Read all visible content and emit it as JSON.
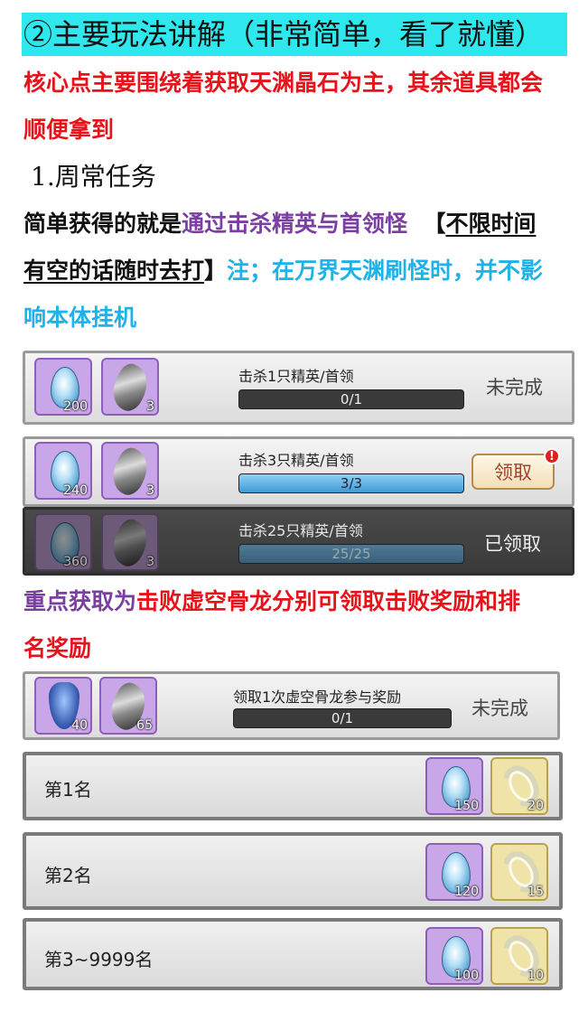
{
  "heading": "②主要玩法讲解（非常简单，看了就懂）",
  "intro_line1": "核心点主要围绕着获取天渊晶石为主，其余道具都会",
  "intro_line2": "顺便拿到",
  "section1_title": "1.周常任务",
  "desc_line1_a": "简单获得的就是",
  "desc_line1_b": "通过击杀精英与首领怪",
  "desc_line1_c": "【",
  "desc_line1_d": "不限时间",
  "desc_line2_a": "有空的话随时去打",
  "desc_line2_b": "】",
  "desc_line2_c": "注；在万界天渊刷怪时，并不影",
  "desc_line3": "响本体挂机",
  "weekly_tasks": [
    {
      "title": "击杀1只精英/首领",
      "progress": "0/1",
      "fraction": 0.0,
      "status": "未完成",
      "reward1_qty": "200",
      "reward2_qty": "3"
    },
    {
      "title": "击杀3只精英/首领",
      "progress": "3/3",
      "fraction": 1.0,
      "button": "领取",
      "alert": "!",
      "reward1_qty": "240",
      "reward2_qty": "3"
    },
    {
      "title": "击杀25只精英/首领",
      "progress": "25/25",
      "fraction": 1.0,
      "status": "已领取",
      "reward1_qty": "360",
      "reward2_qty": "3"
    }
  ],
  "focus_line1_a": "重点获取为",
  "focus_line1_b": "击败虚空骨龙分别可领取击败奖励和排",
  "focus_line2": "名奖励",
  "boss_task": {
    "title": "领取1次虚空骨龙参与奖励",
    "progress": "0/1",
    "fraction": 0.0,
    "status": "未完成",
    "reward1_qty": "40",
    "reward2_qty": "65"
  },
  "ranks": [
    {
      "label": "第1名",
      "crystal_qty": "150",
      "hook_qty": "20"
    },
    {
      "label": "第2名",
      "crystal_qty": "120",
      "hook_qty": "15"
    },
    {
      "label": "第3~9999名",
      "crystal_qty": "100",
      "hook_qty": "10"
    }
  ]
}
